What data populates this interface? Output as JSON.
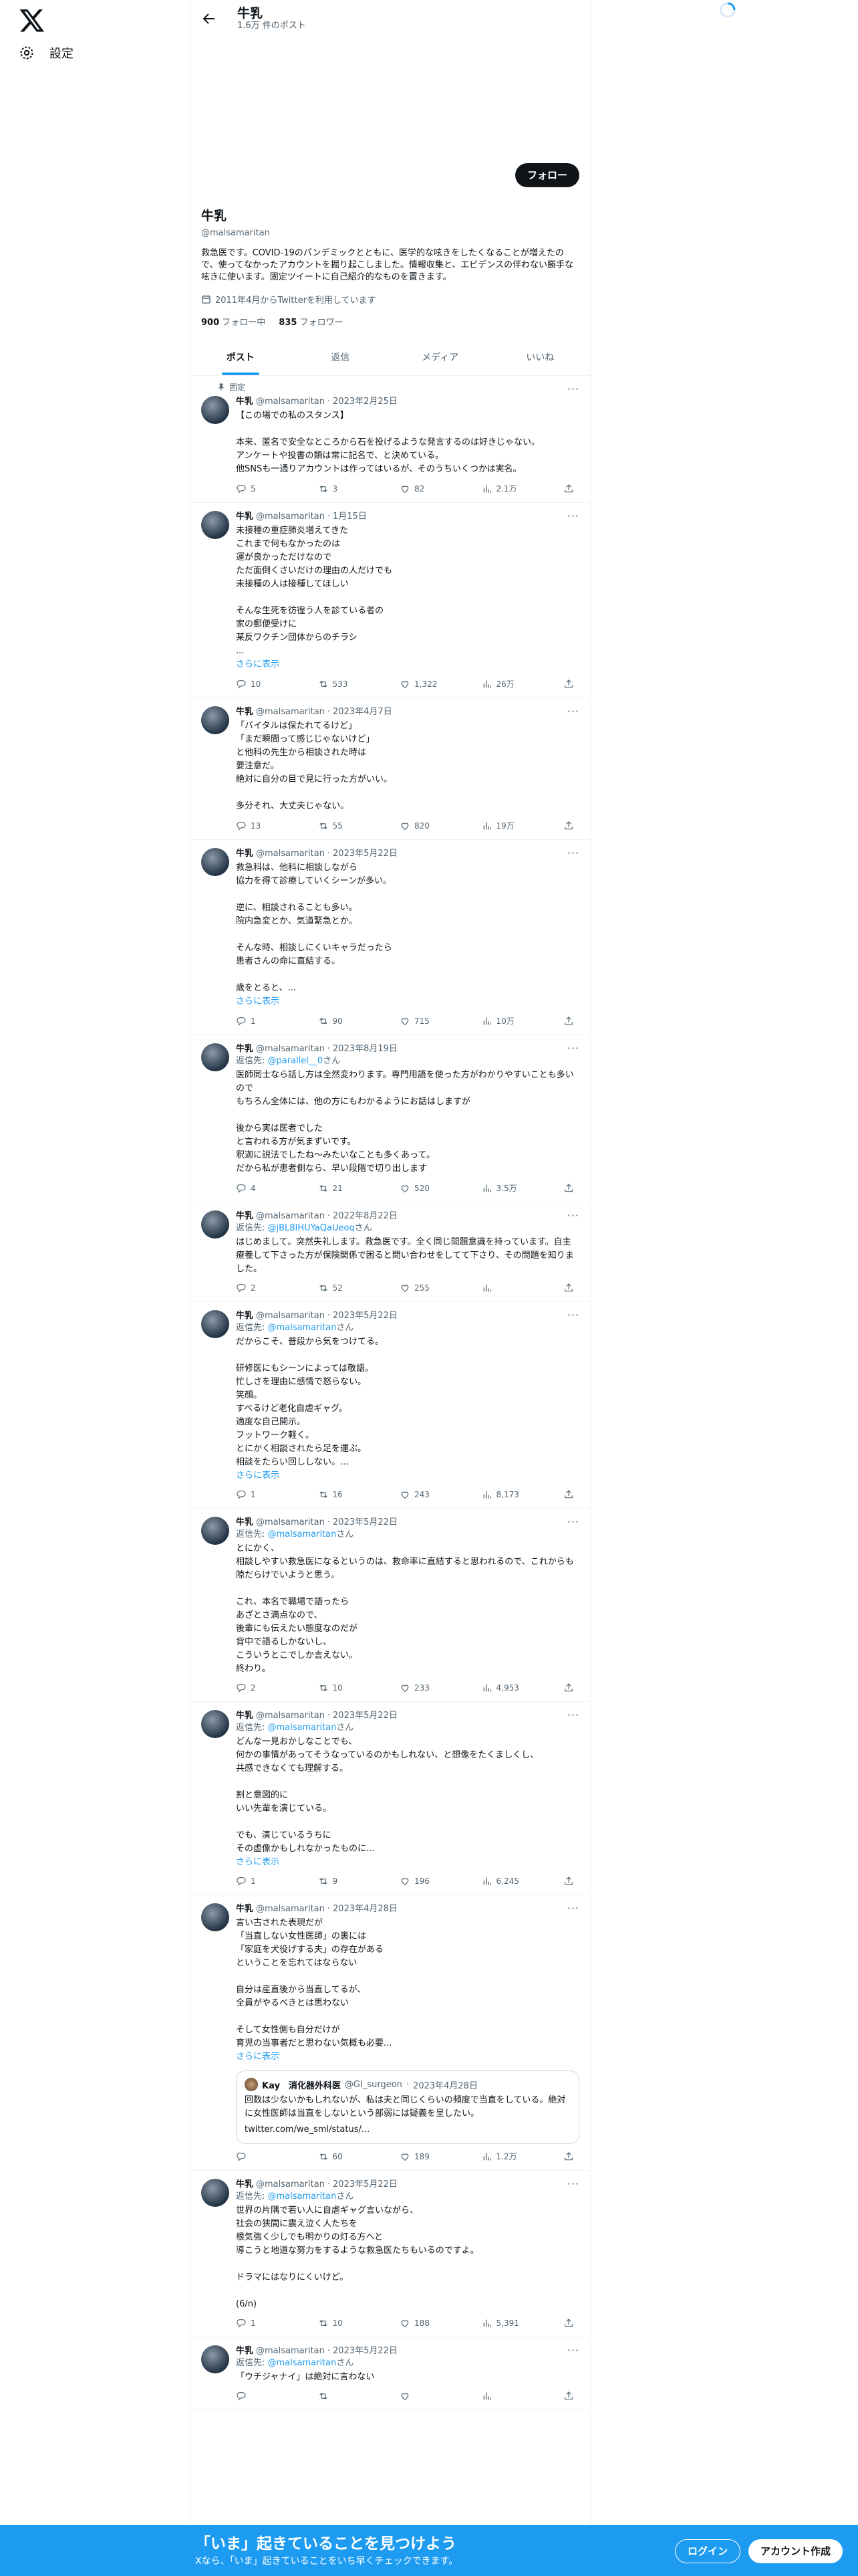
{
  "nav": {
    "settings": "設定"
  },
  "header": {
    "name": "牛乳",
    "post_count": "1.6万 件のポスト"
  },
  "profile": {
    "follow": "フォロー",
    "name": "牛乳",
    "handle": "@malsamaritan",
    "bio": "救急医です。COVID-19のパンデミックとともに、医学的な呟きをしたくなることが増えたので、使ってなかったアカウントを掘り起こしました。情報収集と、エビデンスの伴わない勝手な呟きに使います。固定ツイートに自己紹介的なものを置きます。",
    "joined": "2011年4月からTwitterを利用しています",
    "following_count": "900",
    "following_label": "フォロー中",
    "followers_count": "835",
    "followers_label": "フォロワー"
  },
  "tabs": [
    "ポスト",
    "返信",
    "メディア",
    "いいね"
  ],
  "tweets": [
    {
      "pinned": "固定",
      "name": "牛乳",
      "handle": "@malsamaritan",
      "date": "2023年2月25日",
      "reply_to": "",
      "reply_suffix": "",
      "text": "【この場での私のスタンス】\n\n本来、匿名で安全なところから石を投げるような発言するのは好きじゃない。\nアンケートや投書の類は常に記名で、と決めている。\n他SNSも一通りアカウントは作ってはいるが、そのうちいくつかは実名。",
      "show_more": "",
      "replies": "5",
      "retweets": "3",
      "likes": "82",
      "views": "2.1万"
    },
    {
      "pinned": "",
      "name": "牛乳",
      "handle": "@malsamaritan",
      "date": "1月15日",
      "reply_to": "",
      "reply_suffix": "",
      "text": "未接種の重症肺炎増えてきた\nこれまで何もなかったのは\n運が良かっただけなので\nただ面倒くさいだけの理由の人だけでも\n未接種の人は接種してほしい\n\nそんな生死を彷徨う人を診ている者の\n家の郵便受けに\n某反ワクチン団体からのチラシ\n...",
      "show_more": "さらに表示",
      "replies": "10",
      "retweets": "533",
      "likes": "1,322",
      "views": "26万"
    },
    {
      "pinned": "",
      "name": "牛乳",
      "handle": "@malsamaritan",
      "date": "2023年4月7日",
      "reply_to": "",
      "reply_suffix": "",
      "text": "「バイタルは保たれてるけど」\n「まだ瞬間って感じじゃないけど」\nと他科の先生から相談された時は\n要注意だ。\n絶対に自分の目で見に行った方がいい。\n\n多分それ、大丈夫じゃない。",
      "show_more": "",
      "replies": "13",
      "retweets": "55",
      "likes": "820",
      "views": "19万"
    },
    {
      "pinned": "",
      "name": "牛乳",
      "handle": "@malsamaritan",
      "date": "2023年5月22日",
      "reply_to": "",
      "reply_suffix": "",
      "text": "救急科は、他科に相談しながら\n協力を得て診療していくシーンが多い。\n\n逆に、相談されることも多い。\n院内急変とか、気道緊急とか。\n\nそんな時、相談しにくいキャラだったら\n患者さんの命に直結する。\n\n歳をとると、...",
      "show_more": "さらに表示",
      "replies": "1",
      "retweets": "90",
      "likes": "715",
      "views": "10万"
    },
    {
      "pinned": "",
      "name": "牛乳",
      "handle": "@malsamaritan",
      "date": "2023年8月19日",
      "reply_to": "@parallel__0",
      "reply_suffix": "さん",
      "text": "医師同士なら話し方は全然変わります。専門用語を使った方がわかりやすいことも多いので\nもちろん全体には、他の方にもわかるようにお話はしますが\n\n後から実は医者でした\nと言われる方が気まずいです。\n釈迦に説法でしたね〜みたいなことも多くあって。\nだから私が患者側なら、早い段階で切り出します",
      "show_more": "",
      "replies": "4",
      "retweets": "21",
      "likes": "520",
      "views": "3.5万"
    },
    {
      "pinned": "",
      "name": "牛乳",
      "handle": "@malsamaritan",
      "date": "2022年8月22日",
      "reply_to": "@jBL8IHUYaQaUeoq",
      "reply_suffix": "さん",
      "text": "はじめまして。突然失礼します。救急医です。全く同じ問題意識を持っています。自主療養して下さった方が保険関係で困ると問い合わせをしてて下さり、その問題を知りました。",
      "show_more": "",
      "replies": "2",
      "retweets": "52",
      "likes": "255",
      "views": ""
    },
    {
      "pinned": "",
      "name": "牛乳",
      "handle": "@malsamaritan",
      "date": "2023年5月22日",
      "reply_to": "@malsamaritan",
      "reply_suffix": "さん",
      "text": "だからこそ、普段から気をつけてる。\n\n研修医にもシーンによっては敬語。\n忙しさを理由に感情で怒らない。\n笑顔。\nすべるけど老化自虐ギャグ。\n適度な自己開示。\nフットワーク軽く。\nとにかく相談されたら足を運ぶ。\n相談をたらい回ししない。...",
      "show_more": "さらに表示",
      "replies": "1",
      "retweets": "16",
      "likes": "243",
      "views": "8,173"
    },
    {
      "pinned": "",
      "name": "牛乳",
      "handle": "@malsamaritan",
      "date": "2023年5月22日",
      "reply_to": "@malsamaritan",
      "reply_suffix": "さん",
      "text": "とにかく、\n相談しやすい救急医になるというのは、救命率に直結すると思われるので、これからも隙だらけでいようと思う。\n\nこれ、本名で職場で語ったら\nあざとさ満点なので、\n後輩にも伝えたい態度なのだが\n背中で語るしかないし、\nこういうとこでしか言えない。\n終わり。",
      "show_more": "",
      "replies": "2",
      "retweets": "10",
      "likes": "233",
      "views": "4,953"
    },
    {
      "pinned": "",
      "name": "牛乳",
      "handle": "@malsamaritan",
      "date": "2023年5月22日",
      "reply_to": "@malsamaritan",
      "reply_suffix": "さん",
      "text": "どんな一見おかしなことでも、\n何かの事情があってそうなっているのかもしれない、と想像をたくましくし、\n共感できなくても理解する。\n\n割と意図的に\nいい先輩を演じている。\n\nでも、演じているうちに\nその虚像かもしれなかったものに...",
      "show_more": "さらに表示",
      "replies": "1",
      "retweets": "9",
      "likes": "196",
      "views": "6,245"
    },
    {
      "pinned": "",
      "name": "牛乳",
      "handle": "@malsamaritan",
      "date": "2023年4月28日",
      "reply_to": "",
      "reply_suffix": "",
      "text": "言い古された表現だが\n「当直しない女性医師」の裏には\n「家庭を犬役げする夫」の存在がある\nということを忘れてはならない\n\n自分は産直後から当直してるが、\n全員がやるべきとは思わない\n\nそして女性側も自分だけが\n育児の当事者だと思わない気概も必要...",
      "show_more": "さらに表示",
      "quote": {
        "name": "Kay　消化器外科医",
        "handle": "@GI_surgeon",
        "date": "2023年4月28日",
        "text": "回数は少ないかもしれないが、私は夫と同じくらいの頻度で当直をしている。絶対に女性医師は当直をしないという部弱には疑義を呈したい。",
        "link": "twitter.com/we_sml/status/..."
      },
      "replies": "",
      "retweets": "60",
      "likes": "189",
      "views": "1.2万"
    },
    {
      "pinned": "",
      "name": "牛乳",
      "handle": "@malsamaritan",
      "date": "2023年5月22日",
      "reply_to": "@malsamaritan",
      "reply_suffix": "さん",
      "text": "世界の片隅で若い人に自虐ギャグ言いながら、\n社会の狭間に震え泣く人たちを\n根気強く少しでも明かりの灯る方へと\n導こうと地道な努力をするような救急医たちもいるのですよ。\n\nドラマにはなりにくいけど。\n\n(6/n)",
      "show_more": "",
      "replies": "1",
      "retweets": "10",
      "likes": "188",
      "views": "5,391"
    },
    {
      "pinned": "",
      "name": "牛乳",
      "handle": "@malsamaritan",
      "date": "2023年5月22日",
      "reply_to": "@malsamaritan",
      "reply_suffix": "さん",
      "text": "「ウチジャナイ」は絶対に言わない",
      "show_more": "",
      "replies": "",
      "retweets": "",
      "likes": "",
      "views": ""
    }
  ],
  "bottom_bar": {
    "title": "「いま」起きていることを見つけよう",
    "subtitle": "Xなら、「いま」起きていることをいち早くチェックできます。",
    "login": "ログイン",
    "signup": "アカウント作成"
  },
  "icons": {
    "logo": "x-logo-icon",
    "settings": "gear-icon",
    "back": "arrow-left-icon",
    "calendar": "calendar-icon",
    "pin": "pin-icon",
    "reply": "reply-icon",
    "retweet": "retweet-icon",
    "like": "heart-icon",
    "views": "views-icon",
    "share": "share-icon",
    "more": "more-icon"
  },
  "colors": {
    "accent": "#1d9bf0",
    "text": "#0f1419",
    "muted": "#536471"
  }
}
